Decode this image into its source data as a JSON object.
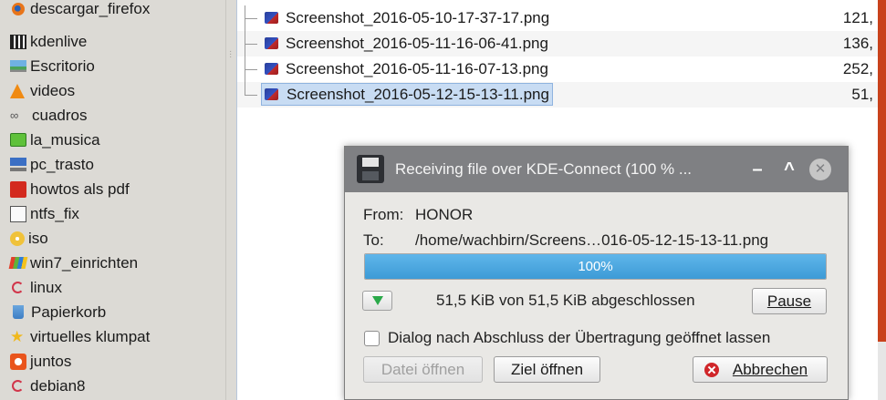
{
  "sidebar": {
    "items": [
      {
        "label": "descargar_firefox",
        "icon": "firefox-icon"
      },
      {
        "label": "kdenlive",
        "icon": "clapperboard-icon"
      },
      {
        "label": "Escritorio",
        "icon": "desktop-icon"
      },
      {
        "label": "videos",
        "icon": "vlc-cone-icon"
      },
      {
        "label": "cuadros",
        "icon": "infinity-icon"
      },
      {
        "label": "la_musica",
        "icon": "folder-green-icon"
      },
      {
        "label": "pc_trasto",
        "icon": "computer-icon"
      },
      {
        "label": "howtos als pdf",
        "icon": "pdf-icon"
      },
      {
        "label": "ntfs_fix",
        "icon": "document-icon"
      },
      {
        "label": "iso",
        "icon": "disc-icon"
      },
      {
        "label": "win7_einrichten",
        "icon": "windows-flag-icon"
      },
      {
        "label": "linux",
        "icon": "debian-swirl-icon"
      },
      {
        "label": "Papierkorb",
        "icon": "trash-icon"
      },
      {
        "label": "virtuelles klumpat",
        "icon": "star-icon"
      },
      {
        "label": "juntos",
        "icon": "ubuntu-icon"
      },
      {
        "label": "debian8",
        "icon": "debian-swirl-icon"
      }
    ]
  },
  "files": {
    "rows": [
      {
        "name": "Screenshot_2016-05-10-17-37-17.png",
        "size": "121,",
        "selected": false
      },
      {
        "name": "Screenshot_2016-05-11-16-06-41.png",
        "size": "136,",
        "selected": false
      },
      {
        "name": "Screenshot_2016-05-11-16-07-13.png",
        "size": "252,",
        "selected": false
      },
      {
        "name": "Screenshot_2016-05-12-15-13-11.png",
        "size": "51,",
        "selected": true
      }
    ]
  },
  "dialog": {
    "title": "Receiving file over KDE-Connect (100 % ...",
    "minimize_symbol": "–",
    "maximize_symbol": "^",
    "close_symbol": "✕",
    "from_label": "From:",
    "from_value": "HONOR",
    "to_label": "To:",
    "to_value": "/home/wachbirn/Screens…016-05-12-15-13-11.png",
    "progress_percent": 100,
    "progress_text": "100%",
    "status_text": "51,5 KiB von 51,5 KiB abgeschlossen",
    "pause_label": "Pause",
    "keep_open_label": "Dialog nach Abschluss der Übertragung geöffnet lassen",
    "keep_open_checked": false,
    "open_file_label": "Datei öffnen",
    "open_dir_label": "Ziel öffnen",
    "cancel_label": "Abbrechen"
  },
  "colors": {
    "selection": "#c8dcf3",
    "progress": "#3d9bd6",
    "titlebar": "#7f8083",
    "accent_right_edge": "#c9421c"
  }
}
